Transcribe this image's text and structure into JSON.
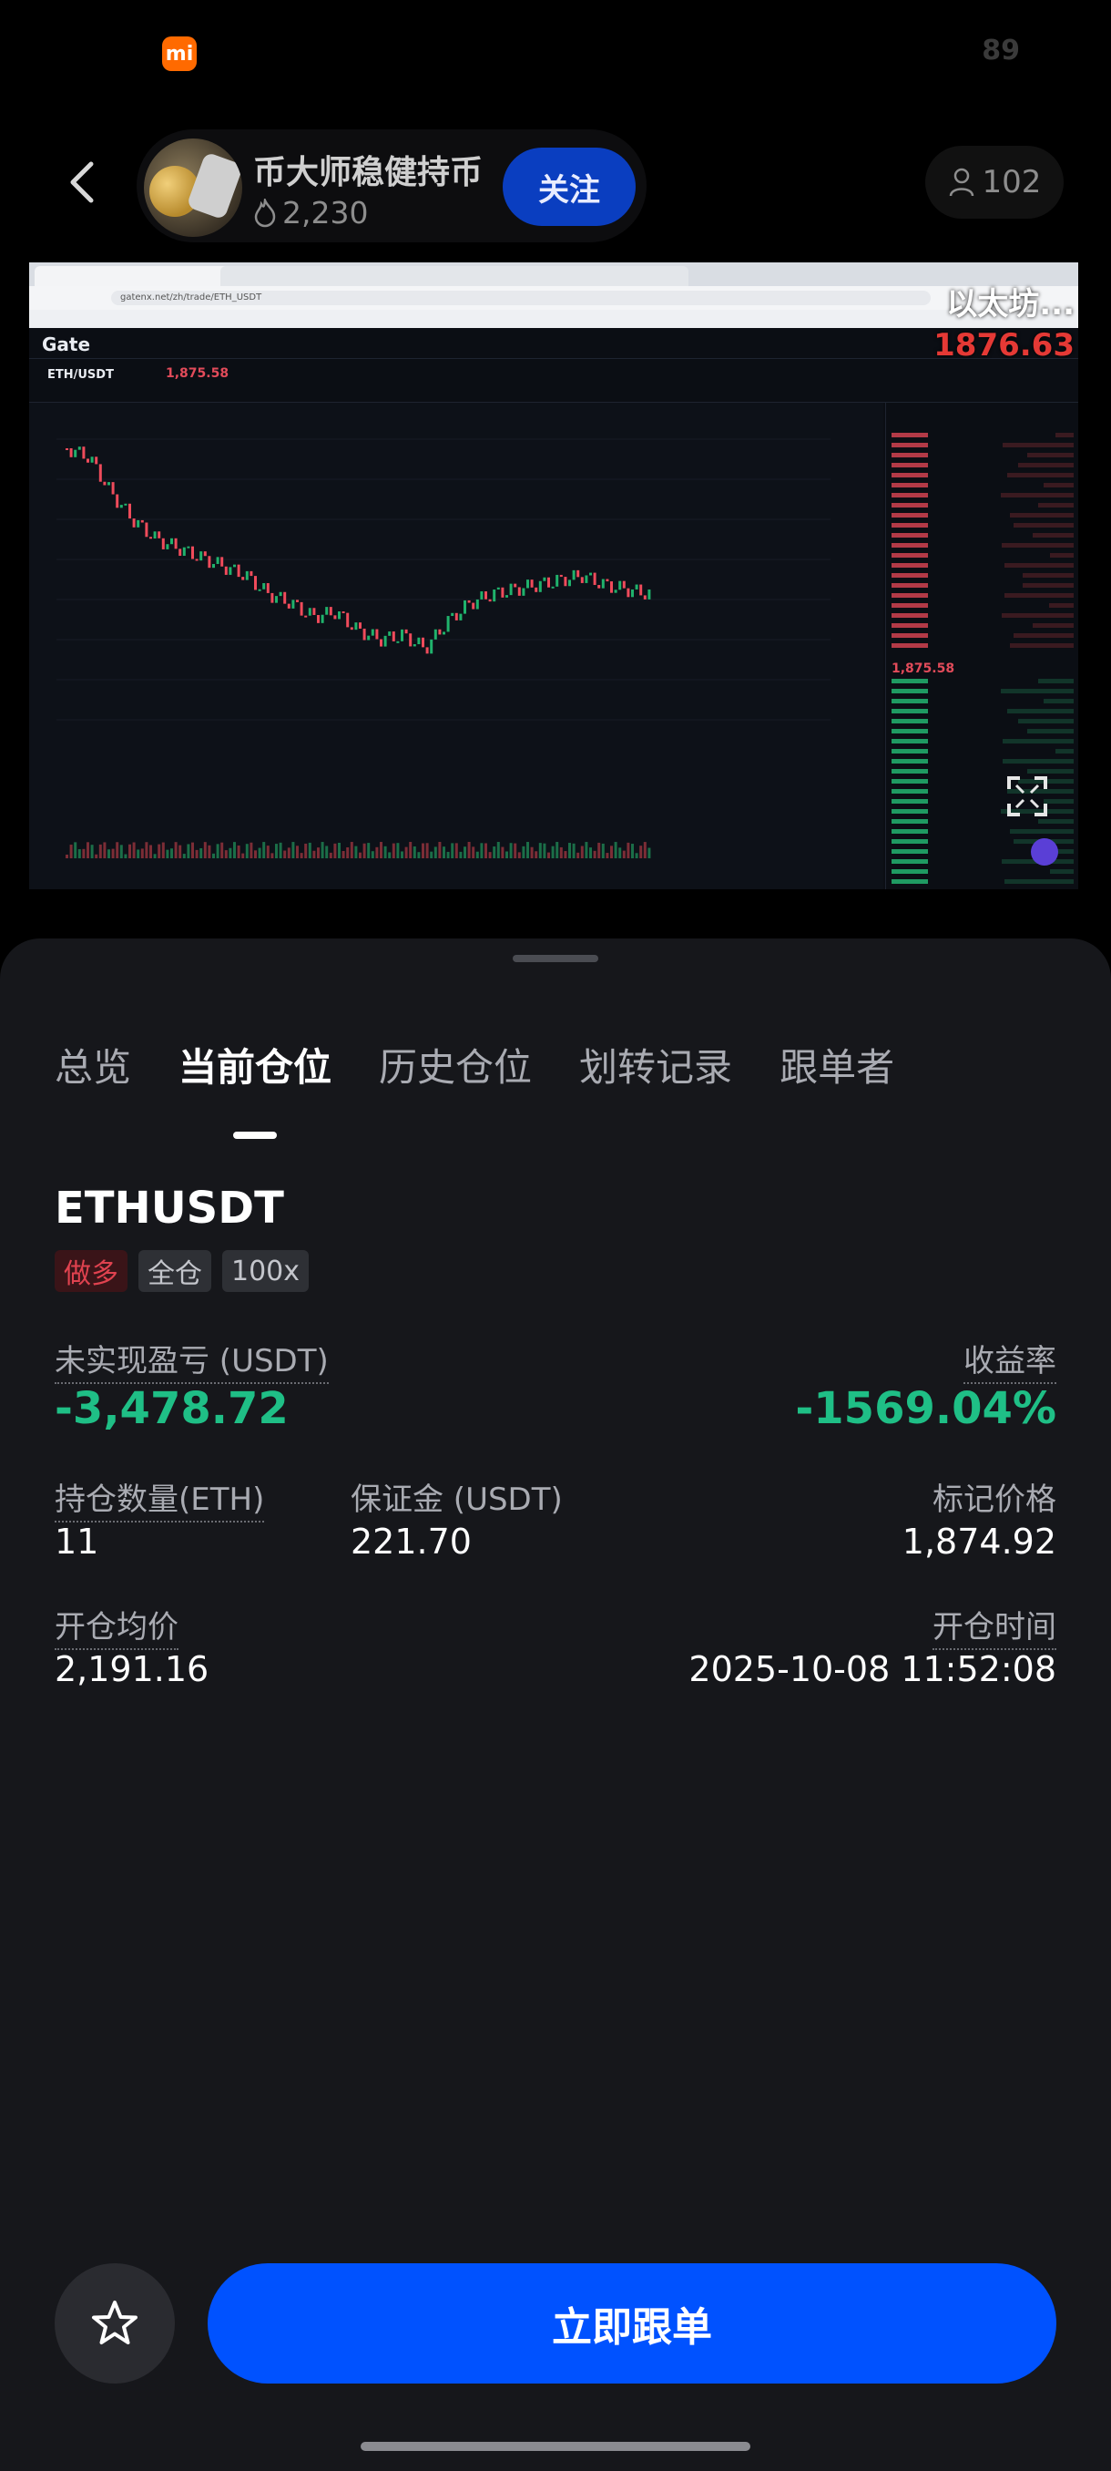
{
  "status_bar": {
    "brand_logo": "mi",
    "battery": "89"
  },
  "header": {
    "creator_name": "币大师稳健持币",
    "heat": "2,230",
    "follow_label": "关注",
    "followers": "102"
  },
  "preview": {
    "asset_name": "以太坊...",
    "asset_price": "1876.63",
    "url": "gatenx.net/zh/trade/ETH_USDT",
    "exchange": "Gate",
    "pair": "ETH/USDT",
    "pair_price": "1,875.58",
    "orderbook_price": "1,875.58"
  },
  "tabs": [
    {
      "label": "总览"
    },
    {
      "label": "当前仓位"
    },
    {
      "label": "历史仓位"
    },
    {
      "label": "划转记录"
    },
    {
      "label": "跟单者"
    }
  ],
  "position": {
    "symbol": "ETHUSDT",
    "side": "做多",
    "margin_mode": "全仓",
    "leverage": "100x",
    "unrealized_pnl_label": "未实现盈亏 (USDT)",
    "unrealized_pnl": "-3,478.72",
    "roi_label": "收益率",
    "roi": "-1569.04%",
    "qty_label": "持仓数量(ETH)",
    "qty": "11",
    "margin_label": "保证金 (USDT)",
    "margin": "221.70",
    "mark_price_label": "标记价格",
    "mark_price": "1,874.92",
    "entry_price_label": "开仓均价",
    "entry_price": "2,191.16",
    "open_time_label": "开仓时间",
    "open_time": "2025-10-08 11:52:08"
  },
  "actions": {
    "follow_trade_label": "立即跟单"
  },
  "colors": {
    "accent": "#0052ff",
    "loss": "#1fbf86",
    "long": "#e0424f"
  }
}
